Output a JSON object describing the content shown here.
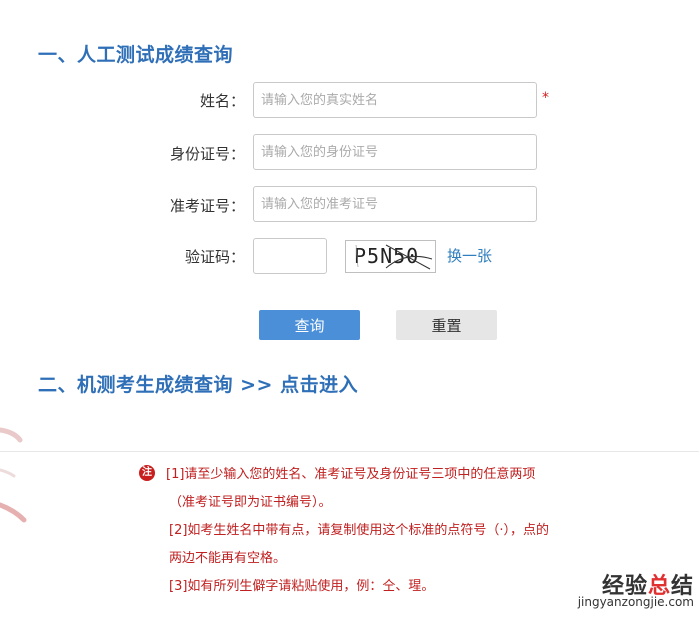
{
  "section1": {
    "title": "一、人工测试成绩查询"
  },
  "form": {
    "name": {
      "label": "姓名：",
      "placeholder": "请输入您的真实姓名",
      "required_mark": "*"
    },
    "id_card": {
      "label": "身份证号：",
      "placeholder": "请输入您的身份证号"
    },
    "exam_no": {
      "label": "准考证号：",
      "placeholder": "请输入您的准考证号"
    },
    "captcha": {
      "label": "验证码：",
      "value": "",
      "image_text": "P5N50",
      "refresh_label": "换一张"
    },
    "query_button": "查询",
    "reset_button": "重置"
  },
  "section2": {
    "title": "二、机测考生成绩查询",
    "link": ">> 点击进入"
  },
  "notes": {
    "icon": "注",
    "lines": [
      "[1]请至少输入您的姓名、准考证号及身份证号三项中的任意两项",
      "（准考证号即为证书编号）。",
      "[2]如考生姓名中带有点，请复制使用这个标准的点符号（·），点的",
      "两边不能再有空格。",
      "[3]如有所列生僻字请粘贴使用，例：仝、瑆。"
    ]
  },
  "watermark": {
    "main_prefix": "经验",
    "main_highlight": "总",
    "main_suffix": "结",
    "sub": "jingyanzongjie.com"
  },
  "colors": {
    "accent": "#2f6fb7",
    "button": "#4a8fd8",
    "note": "#c02020",
    "required": "#d32020"
  }
}
